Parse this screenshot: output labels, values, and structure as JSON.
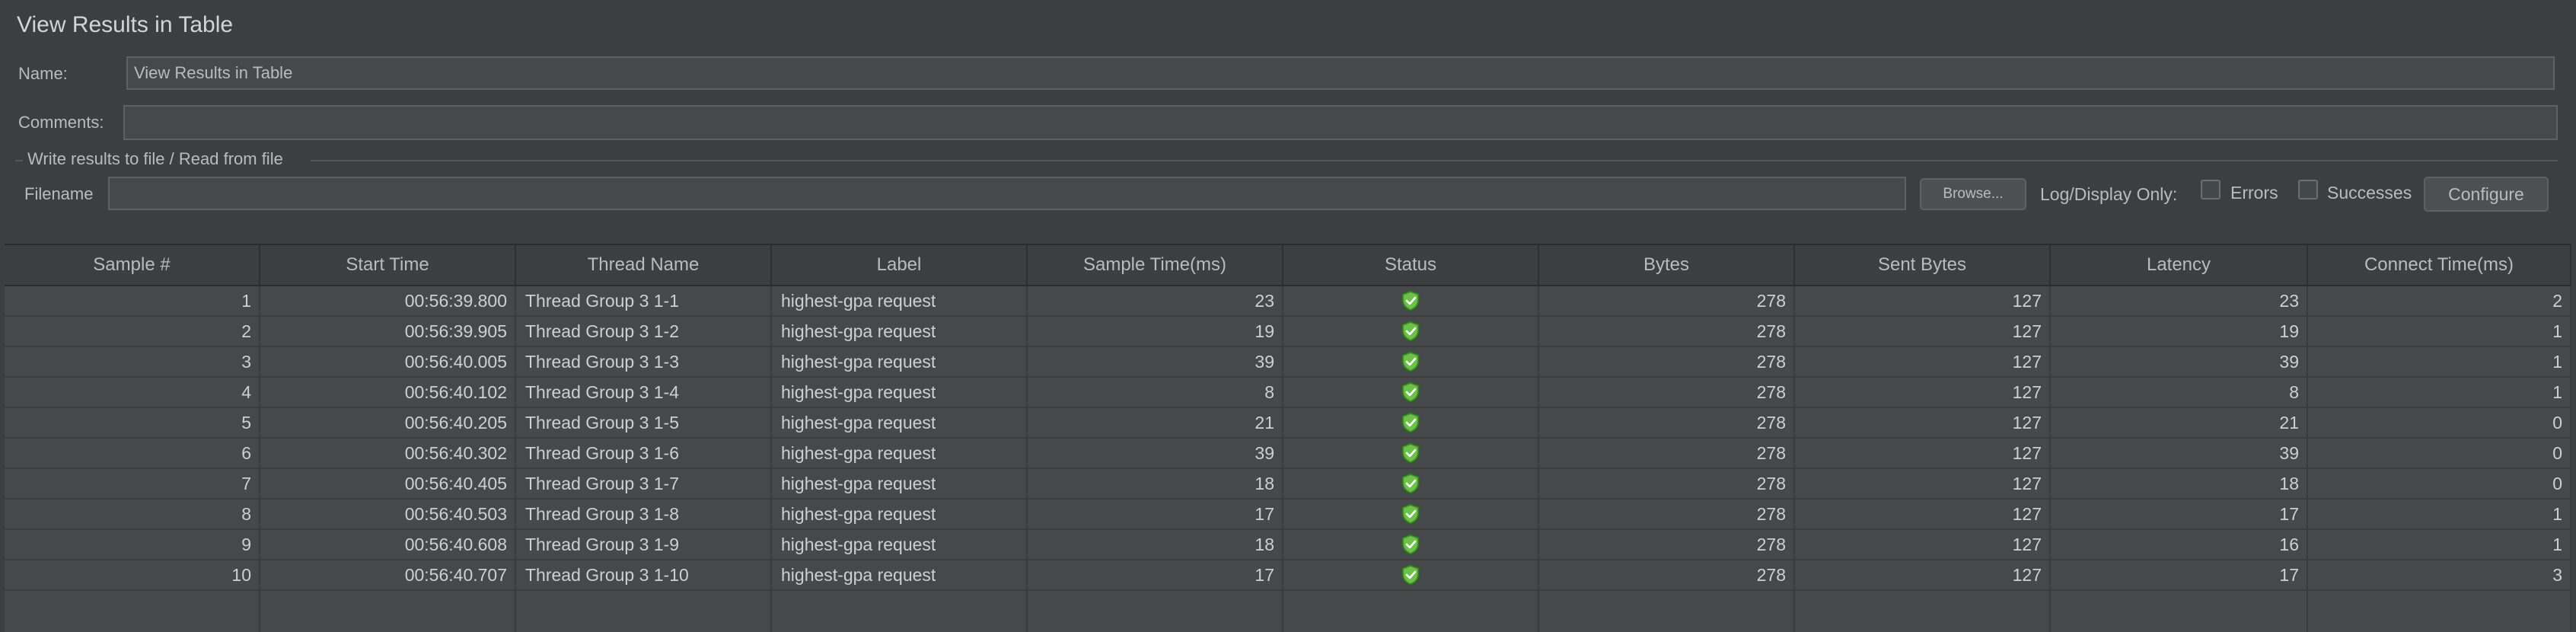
{
  "panel": {
    "title": "View Results in Table",
    "name_label": "Name:",
    "name_value": "View Results in Table",
    "comments_label": "Comments:",
    "comments_value": ""
  },
  "file_group": {
    "title": "Write results to file / Read from file",
    "filename_label": "Filename",
    "filename_value": "",
    "browse_label": "Browse...",
    "log_display_label": "Log/Display Only:",
    "errors_label": "Errors",
    "successes_label": "Successes",
    "configure_label": "Configure"
  },
  "status_icon": "green-shield-check-icon",
  "colors": {
    "background": "#3c3f41",
    "field": "#45494a",
    "shield": "#5fb336"
  },
  "table": {
    "columns": [
      "Sample #",
      "Start Time",
      "Thread Name",
      "Label",
      "Sample Time(ms)",
      "Status",
      "Bytes",
      "Sent Bytes",
      "Latency",
      "Connect Time(ms)"
    ],
    "rows": [
      [
        "1",
        "00:56:39.800",
        "Thread Group 3 1-1",
        "highest-gpa request",
        "23",
        "",
        "278",
        "127",
        "23",
        "2"
      ],
      [
        "2",
        "00:56:39.905",
        "Thread Group 3 1-2",
        "highest-gpa request",
        "19",
        "",
        "278",
        "127",
        "19",
        "1"
      ],
      [
        "3",
        "00:56:40.005",
        "Thread Group 3 1-3",
        "highest-gpa request",
        "39",
        "",
        "278",
        "127",
        "39",
        "1"
      ],
      [
        "4",
        "00:56:40.102",
        "Thread Group 3 1-4",
        "highest-gpa request",
        "8",
        "",
        "278",
        "127",
        "8",
        "1"
      ],
      [
        "5",
        "00:56:40.205",
        "Thread Group 3 1-5",
        "highest-gpa request",
        "21",
        "",
        "278",
        "127",
        "21",
        "0"
      ],
      [
        "6",
        "00:56:40.302",
        "Thread Group 3 1-6",
        "highest-gpa request",
        "39",
        "",
        "278",
        "127",
        "39",
        "0"
      ],
      [
        "7",
        "00:56:40.405",
        "Thread Group 3 1-7",
        "highest-gpa request",
        "18",
        "",
        "278",
        "127",
        "18",
        "0"
      ],
      [
        "8",
        "00:56:40.503",
        "Thread Group 3 1-8",
        "highest-gpa request",
        "17",
        "",
        "278",
        "127",
        "17",
        "1"
      ],
      [
        "9",
        "00:56:40.608",
        "Thread Group 3 1-9",
        "highest-gpa request",
        "18",
        "",
        "278",
        "127",
        "16",
        "1"
      ],
      [
        "10",
        "00:56:40.707",
        "Thread Group 3 1-10",
        "highest-gpa request",
        "17",
        "",
        "278",
        "127",
        "17",
        "3"
      ]
    ]
  }
}
